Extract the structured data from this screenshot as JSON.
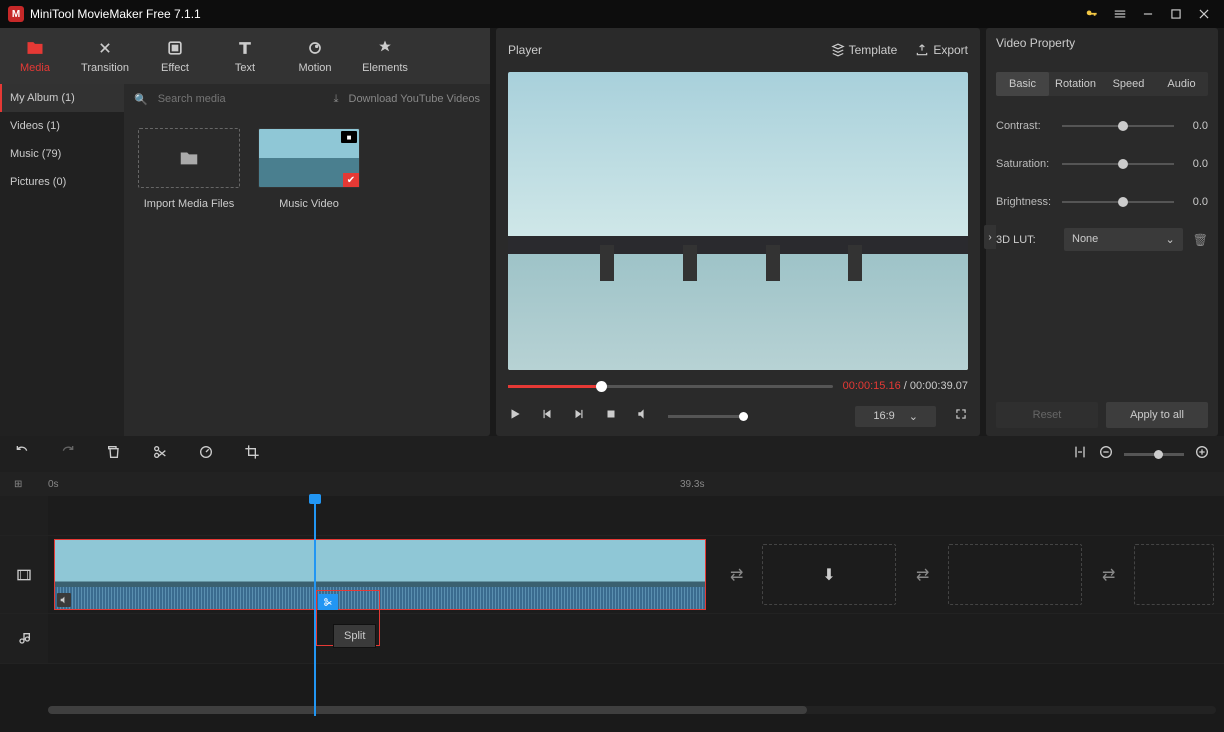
{
  "titlebar": {
    "title": "MiniTool MovieMaker Free 7.1.1"
  },
  "toolbar": {
    "media": "Media",
    "transition": "Transition",
    "effect": "Effect",
    "text": "Text",
    "motion": "Motion",
    "elements": "Elements"
  },
  "sidenav": {
    "album": "My Album (1)",
    "videos": "Videos (1)",
    "music": "Music (79)",
    "pictures": "Pictures (0)"
  },
  "media": {
    "search_ph": "Search media",
    "download": "Download YouTube Videos",
    "import": "Import Media Files",
    "clip1": "Music Video"
  },
  "player": {
    "title": "Player",
    "template": "Template",
    "export": "Export",
    "cur": "00:00:15.16",
    "sep": " / ",
    "total": "00:00:39.07",
    "aspect": "16:9"
  },
  "props": {
    "title": "Video Property",
    "tabs": {
      "basic": "Basic",
      "rotation": "Rotation",
      "speed": "Speed",
      "audio": "Audio"
    },
    "contrast_l": "Contrast:",
    "contrast_v": "0.0",
    "sat_l": "Saturation:",
    "sat_v": "0.0",
    "bri_l": "Brightness:",
    "bri_v": "0.0",
    "lut_l": "3D LUT:",
    "lut_v": "None",
    "reset": "Reset",
    "apply": "Apply to all"
  },
  "timeline": {
    "zero": "0s",
    "end": "39.3s",
    "tooltip": "Split"
  }
}
